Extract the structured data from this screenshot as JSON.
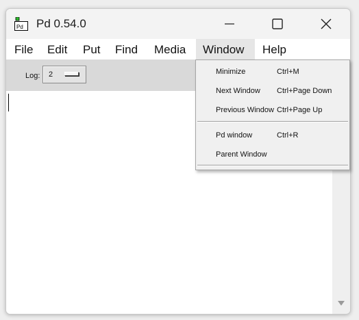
{
  "window": {
    "title": "Pd 0.54.0",
    "icon_text": "Pd",
    "controls": {
      "minimize": "minimize-icon",
      "maximize": "maximize-icon",
      "close": "close-icon"
    }
  },
  "menubar": {
    "items": [
      "File",
      "Edit",
      "Put",
      "Find",
      "Media",
      "Window",
      "Help"
    ],
    "active": "Window"
  },
  "toolbar": {
    "log_label": "Log:",
    "log_value": "2"
  },
  "window_menu": {
    "items": [
      {
        "label": "Minimize",
        "shortcut": "Ctrl+M"
      },
      {
        "label": "Next Window",
        "shortcut": "Ctrl+Page Down"
      },
      {
        "label": "Previous Window",
        "shortcut": "Ctrl+Page Up"
      },
      {
        "label": "Pd window",
        "shortcut": "Ctrl+R"
      },
      {
        "label": "Parent Window",
        "shortcut": ""
      }
    ]
  },
  "colors": {
    "toolbar_bg": "#d9d9d9",
    "menu_bg": "#f0f0f0",
    "console_bg": "#ffffff",
    "icon_green": "#2dbd2d"
  }
}
